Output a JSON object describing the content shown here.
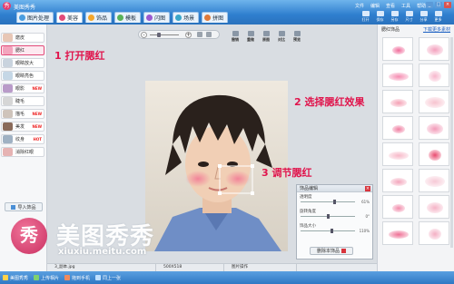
{
  "window": {
    "title": "美图秀秀",
    "menu": [
      "文件",
      "编辑",
      "查看",
      "工具",
      "帮助"
    ],
    "controls": [
      "_",
      "□",
      "×"
    ]
  },
  "tabs": [
    {
      "label": "图片处理",
      "color": "#4a9de0"
    },
    {
      "label": "美容",
      "color": "#e34b7a",
      "active": true
    },
    {
      "label": "饰品",
      "color": "#f4a62a"
    },
    {
      "label": "模板",
      "color": "#59b259"
    },
    {
      "label": "闪图",
      "color": "#9b59d0"
    },
    {
      "label": "场景",
      "color": "#3aa6c9"
    },
    {
      "label": "拼图",
      "color": "#e07a3a"
    }
  ],
  "toolbar_right": [
    "打开",
    "保存",
    "另存",
    "尺寸",
    "分享",
    "更多"
  ],
  "left_tools": [
    {
      "label": "磨皮",
      "tag": ""
    },
    {
      "label": "腮红",
      "tag": "",
      "selected": true
    },
    {
      "label": "眼睛放大",
      "tag": ""
    },
    {
      "label": "眼睛亮色",
      "tag": ""
    },
    {
      "label": "眼影",
      "tag": "NEW"
    },
    {
      "label": "睫毛",
      "tag": ""
    },
    {
      "label": "描毛",
      "tag": "NEW"
    },
    {
      "label": "美发",
      "tag": "NEW"
    },
    {
      "label": "纹身",
      "tag": "HOT"
    },
    {
      "label": "消除红眼",
      "tag": ""
    }
  ],
  "import_button": "导入饰品",
  "edit_tools": [
    "撤销",
    "重做",
    "原图",
    "对比",
    "预览"
  ],
  "annotations": {
    "step1": "1 打开腮红",
    "step2": "2 选择腮红效果",
    "step3": "3 调节腮红"
  },
  "settings_panel": {
    "title": "饰品编辑",
    "rows": [
      {
        "label": "透明度",
        "value": "61%",
        "level": 0.61
      },
      {
        "label": "旋转角度",
        "value": "0°",
        "level": 0.5
      },
      {
        "label": "饰品大小",
        "value": "110%",
        "level": 0.55
      }
    ],
    "reset_label": "删除本饰品"
  },
  "right_panel": {
    "title": "腮红饰品",
    "link": "下载更多素材",
    "swatches": [
      "#f06b9a",
      "#f3a0bd",
      "#f58bb0",
      "#f7b6cc",
      "#f4a0b4",
      "#f7c3cf",
      "#ef7b9f",
      "#f29ab8",
      "#f7b8c8",
      "#e94b6f",
      "#f3a6bc",
      "#f6c9d6",
      "#f18aaa",
      "#f5b3c6",
      "#ee6f94",
      "#f4aec3"
    ]
  },
  "watermark": {
    "logo_char": "秀",
    "name": "美图秀秀",
    "url": "xiuxiu.meitu.com"
  },
  "status": [
    "3_副本.jpg",
    "500X518",
    "图片操作"
  ],
  "taskbar": [
    "美图秀秀",
    "上传相片",
    "拖到手机",
    "同上一张"
  ]
}
